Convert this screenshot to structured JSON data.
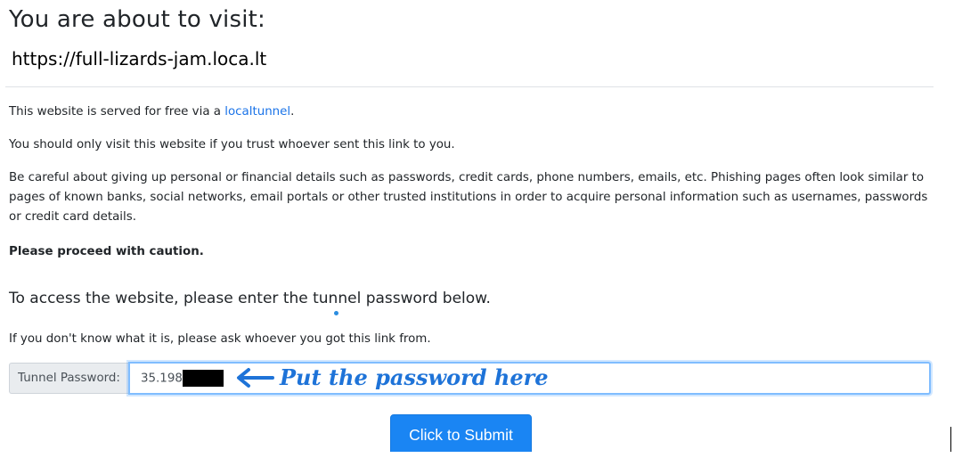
{
  "header": {
    "title": "You are about to visit:",
    "url": "https://full-lizards-jam.loca.lt"
  },
  "content": {
    "p1_before": "This website is served for free via a ",
    "p1_link": "localtunnel",
    "p1_after": ".",
    "p2": "You should only visit this website if you trust whoever sent this link to you.",
    "p3": "Be careful about giving up personal or financial details such as passwords, credit cards, phone numbers, emails, etc. Phishing pages often look similar to pages of known banks, social networks, email portals or other trusted institutions in order to acquire personal information such as usernames, passwords or credit card details.",
    "p4": "Please proceed with caution.",
    "access_heading": "To access the website, please enter the tunnel password below.",
    "p5": "If you don't know what it is, please ask whoever you got this link from."
  },
  "form": {
    "label": "Tunnel Password:",
    "value": "35.198",
    "annotation": "Put the password here",
    "submit_label": "Click to Submit"
  },
  "colors": {
    "link": "#1a73e8",
    "button": "#1a85f3",
    "annotation": "#1e73d8"
  }
}
